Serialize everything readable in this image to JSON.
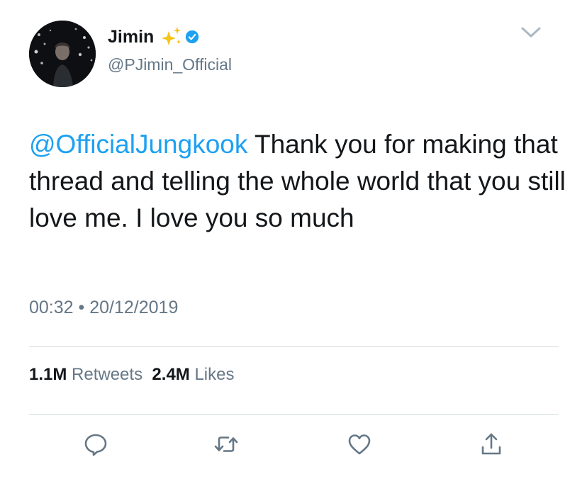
{
  "user": {
    "name": "Jimin",
    "handle": "@PJimin_Official"
  },
  "tweet": {
    "mention": "@OfficialJungkook",
    "body": " Thank you for making that thread and telling the whole world that you still love me. I love you so much",
    "time": "00:32",
    "separator": "•",
    "date": "20/12/2019"
  },
  "stats": {
    "retweets_count": "1.1M",
    "retweets_label": "Retweets",
    "likes_count": "2.4M",
    "likes_label": "Likes"
  },
  "icons": {
    "sparkle": "sparkles-emoji-icon",
    "verified": "verified-badge-icon",
    "more": "chevron-down-icon",
    "reply": "reply-bubble-icon",
    "retweet": "retweet-icon",
    "like": "heart-icon",
    "share": "share-icon"
  },
  "colors": {
    "link": "#1da1f2",
    "secondary_text": "#657786",
    "primary_text": "#14171a",
    "sparkle": "#f5c518"
  }
}
